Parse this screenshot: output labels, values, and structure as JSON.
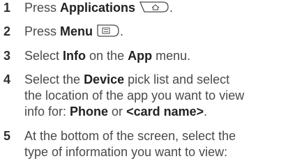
{
  "steps": [
    {
      "number": "1",
      "parts": {
        "a": "Press ",
        "b": "Applications",
        "c": "."
      },
      "icon": "home-key-icon"
    },
    {
      "number": "2",
      "parts": {
        "a": "Press ",
        "b": "Menu",
        "c": "."
      },
      "icon": "menu-key-icon"
    },
    {
      "number": "3",
      "parts": {
        "a": "Select ",
        "b": "Info",
        "c": " on the ",
        "d": "App",
        "e": " menu."
      }
    },
    {
      "number": "4",
      "lines": {
        "l1_a": "Select the ",
        "l1_b": "Device",
        "l1_c": " pick list and select",
        "l2": "the location of the app you want to view",
        "l3_a": "info for: ",
        "l3_b": "Phone",
        "l3_c": " or ",
        "l3_d": "<card name>",
        "l3_e": "."
      }
    },
    {
      "number": "5",
      "lines": {
        "l1": "At the bottom of the screen, select the",
        "l2": "type of information you want to view:"
      }
    }
  ],
  "colors": {
    "text": "#4a4a4a",
    "bold": "#222222",
    "icon_stroke": "#4a4a4a"
  }
}
